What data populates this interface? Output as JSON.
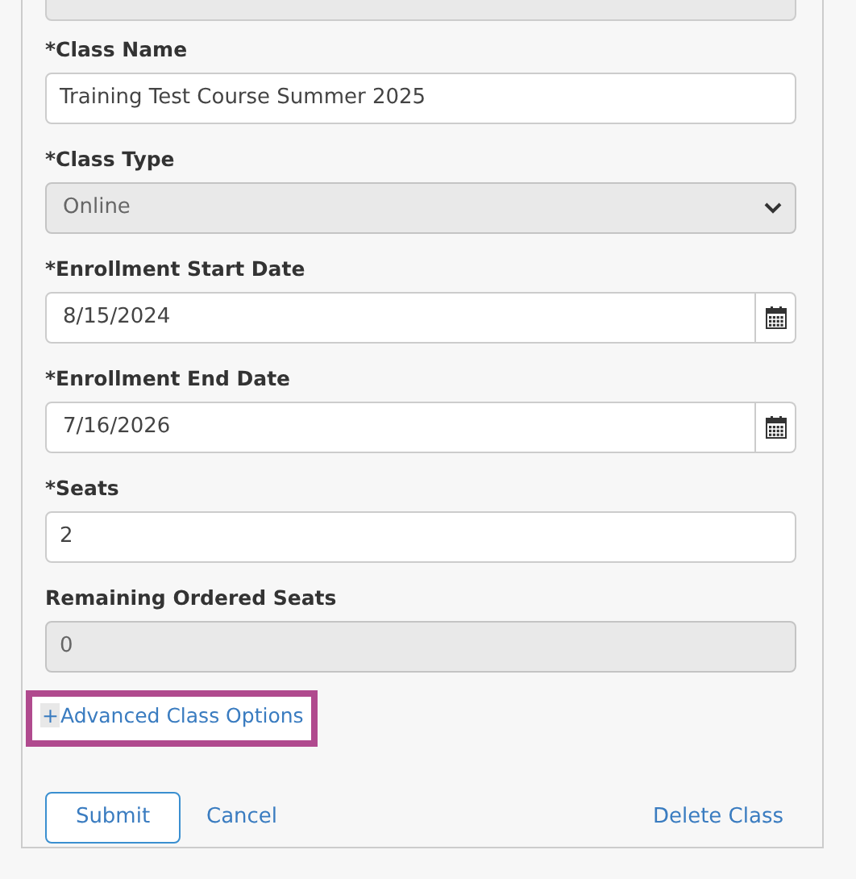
{
  "top_field": {
    "disabled": true
  },
  "fields": [
    {
      "kind": "text",
      "label": "*Class Name",
      "value": "Training Test Course Summer 2025",
      "disabled": false
    },
    {
      "kind": "select",
      "label": "*Class Type",
      "value": "Online",
      "disabled": true
    },
    {
      "kind": "date",
      "label": "*Enrollment Start Date",
      "value": "8/15/2024",
      "disabled": false
    },
    {
      "kind": "date",
      "label": "*Enrollment End Date",
      "value": "7/16/2026",
      "disabled": false
    },
    {
      "kind": "text",
      "label": "*Seats",
      "value": "2",
      "disabled": false
    },
    {
      "kind": "text",
      "label": "Remaining Ordered Seats",
      "value": "0",
      "disabled": true
    }
  ],
  "advanced_link": {
    "toggle": "+",
    "label": "Advanced Class Options",
    "highlighted": true
  },
  "buttons": {
    "submit": "Submit",
    "cancel": "Cancel",
    "delete": "Delete Class"
  }
}
